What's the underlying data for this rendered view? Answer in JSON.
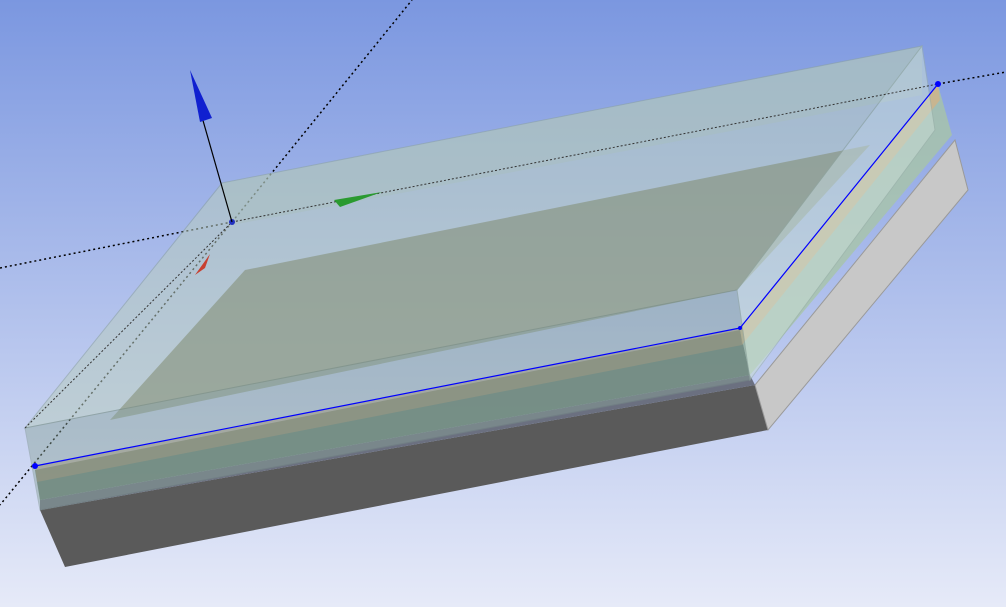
{
  "viewport": {
    "background_top": "#7b97e0",
    "background_bottom": "#e6eaf8",
    "parts": [
      "transparent-top-box",
      "orange-layer",
      "green-layer",
      "gray-base-block"
    ],
    "colors": {
      "base_front": "#5a5a5a",
      "base_side": "#c8c8c8",
      "glass": "#b8d0c8",
      "layer_orange": "#c8a070",
      "edge_selected": "#0000ff"
    },
    "triad": {
      "icons": [
        "z-axis-arrow-icon",
        "y-axis-arrow-icon",
        "x-axis-arrow-icon"
      ],
      "colors": {
        "z": "#1020d0",
        "y": "#2a9a30",
        "x": "#c84030"
      }
    }
  }
}
